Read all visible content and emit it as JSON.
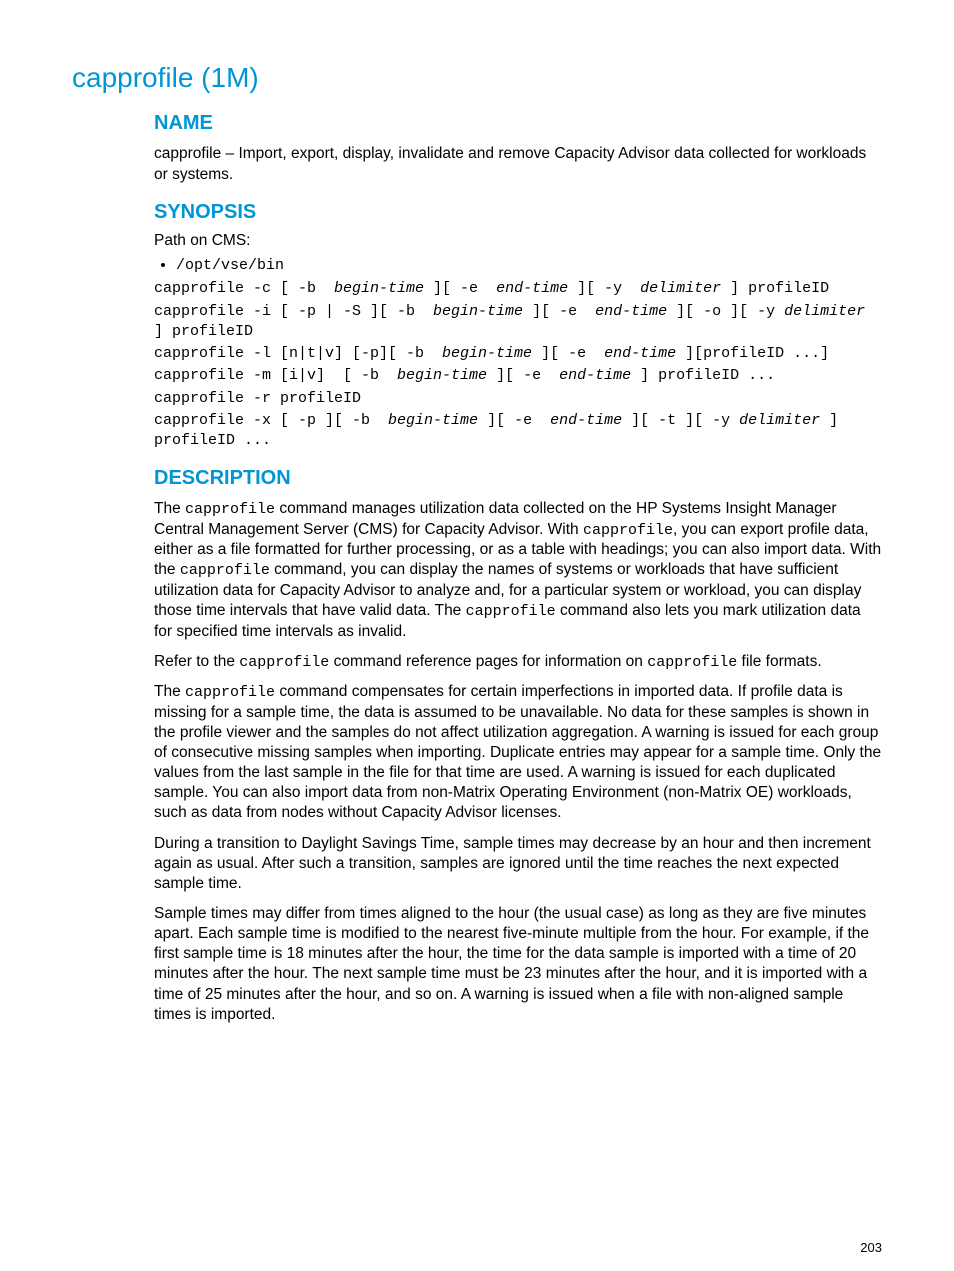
{
  "title": "capprofile (1M)",
  "sections": {
    "name_h": "NAME",
    "name_p": "capprofile – Import, export, display, invalidate and remove Capacity Advisor data collected for workloads or systems.",
    "syn_h": "SYNOPSIS",
    "syn_path": "Path on CMS:",
    "syn_bullet": "/opt/vse/bin",
    "syn_lines": {
      "l1a": "capprofile -c [ -b  ",
      "l1b": "begin-time",
      "l1c": " ][ -e  ",
      "l1d": "end-time",
      "l1e": " ][ -y  ",
      "l1f": "delimiter",
      "l1g": " ] profileID",
      "l2a": "capprofile -i [ -p | -S ][ -b  ",
      "l2b": "begin-time",
      "l2c": " ][ -e  ",
      "l2d": "end-time",
      "l2e": " ][ -o ][ -y ",
      "l2f": "delimiter",
      "l2g": " ] profileID",
      "l3a": "capprofile -l [n|t|v] [-p][ -b  ",
      "l3b": "begin-time",
      "l3c": " ][ -e  ",
      "l3d": "end-time",
      "l3e": " ][profileID ...]",
      "l4a": "capprofile -m [i|v]  [ -b  ",
      "l4b": "begin-time",
      "l4c": " ][ -e  ",
      "l4d": "end-time",
      "l4e": " ] profileID ...",
      "l5a": "capprofile -r profileID",
      "l6a": "capprofile -x [ -p ][ -b  ",
      "l6b": "begin-time",
      "l6c": " ][ -e  ",
      "l6d": "end-time",
      "l6e": " ][ -t ][ -y ",
      "l6f": "delimiter",
      "l6g": " ] profileID ..."
    },
    "desc_h": "DESCRIPTION",
    "desc_p1_a": "The ",
    "desc_p1_cmd1": "capprofile",
    "desc_p1_b": " command manages utilization data collected on the HP Systems Insight Manager Central Management Server (CMS) for Capacity Advisor. With ",
    "desc_p1_cmd2": "capprofile",
    "desc_p1_c": ", you can export profile data, either as a file formatted for further processing, or as a table with headings; you can also import data. With the ",
    "desc_p1_cmd3": "capprofile",
    "desc_p1_d": " command, you can display the names of systems or workloads that have sufficient utilization data for Capacity Advisor to analyze and, for a particular system or workload, you can display those time intervals that have valid data. The ",
    "desc_p1_cmd4": "capprofile",
    "desc_p1_e": " command also lets you mark utilization data for specified time intervals as invalid.",
    "desc_p2_a": "Refer to the ",
    "desc_p2_cmd1": "capprofile",
    "desc_p2_b": " command reference pages for information on ",
    "desc_p2_cmd2": "capprofile",
    "desc_p2_c": " file formats.",
    "desc_p3_a": "The ",
    "desc_p3_cmd1": "capprofile",
    "desc_p3_b": " command compensates for certain imperfections in imported data. If profile data is missing for a sample time, the data is assumed to be unavailable. No data for these samples is shown in the profile viewer and the samples do not affect utilization aggregation. A warning is issued for each group of consecutive missing samples when importing. Duplicate entries may appear for a sample time. Only the values from the last sample in the file for that time are used. A warning is issued for each duplicated sample. You can also import data from non-Matrix Operating Environment (non-Matrix OE) workloads, such as data from nodes without Capacity Advisor licenses.",
    "desc_p4": "During a transition to Daylight Savings Time, sample times may decrease by an hour and then increment again as usual. After such a transition, samples are ignored until the time reaches the next expected sample time.",
    "desc_p5": "Sample times may differ from times aligned to the hour (the usual case) as long as they are five minutes apart. Each sample time is modified to the nearest five-minute multiple from the hour. For example, if the first sample time is 18 minutes after the hour, the time for the data sample is imported with a time of 20 minutes after the hour. The next sample time must be 23 minutes after the hour, and it is imported with a time of 25 minutes after the hour, and so on. A warning is issued when a file with non-aligned sample times is imported."
  },
  "page_number": "203"
}
